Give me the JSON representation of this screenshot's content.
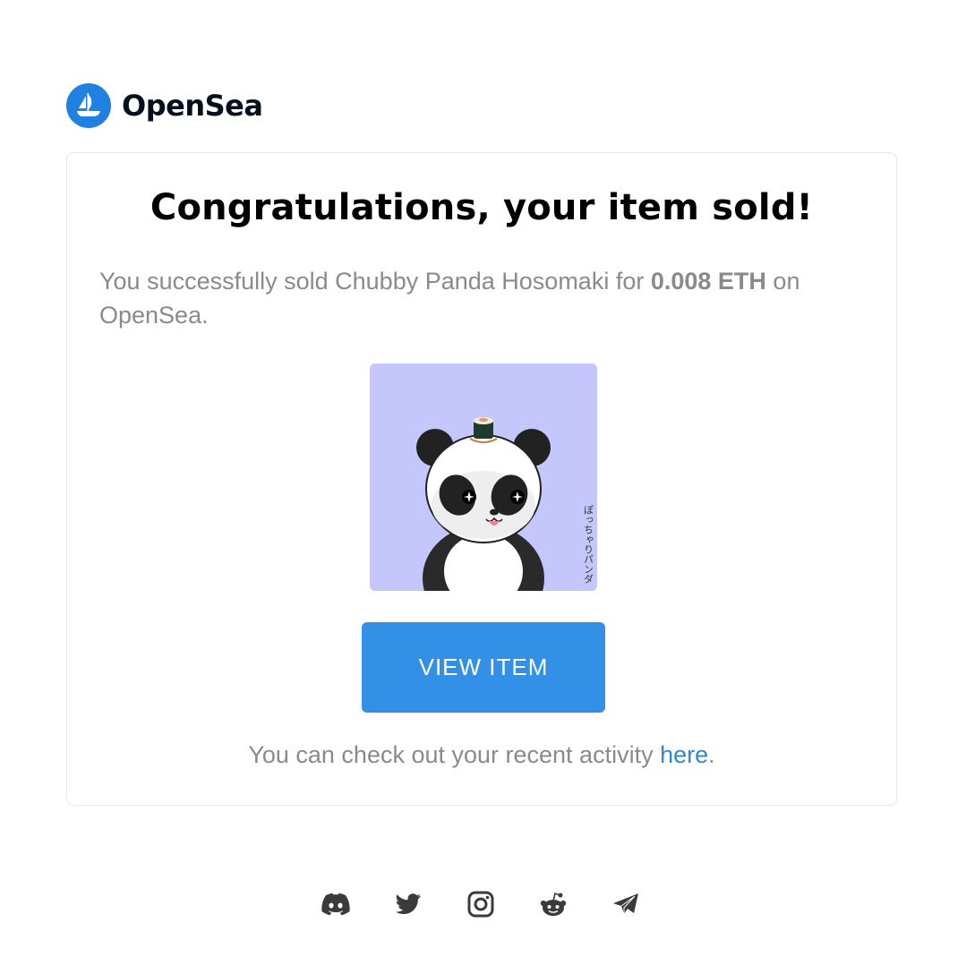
{
  "brand": {
    "name": "OpenSea",
    "accent_color": "#2081e2",
    "logo_icon": "opensea-ship-icon"
  },
  "email": {
    "headline": "Congratulations, your item sold!",
    "message": {
      "prefix": "You successfully sold Chubby Panda Hosomaki for ",
      "price": "0.008 ETH",
      "suffix": " on OpenSea."
    },
    "nft": {
      "image_icon": "chubby-panda-artwork",
      "background_color": "#c5c6fb",
      "artwork_text": "ぽっちゃりパンダ"
    },
    "button_label": "VIEW ITEM",
    "button_color": "#3291e6",
    "activity": {
      "prefix": "You can check out your recent activity ",
      "link_text": "here",
      "suffix": "."
    }
  },
  "footer": {
    "social_icons": [
      "discord-icon",
      "twitter-icon",
      "instagram-icon",
      "reddit-icon",
      "telegram-icon"
    ]
  }
}
